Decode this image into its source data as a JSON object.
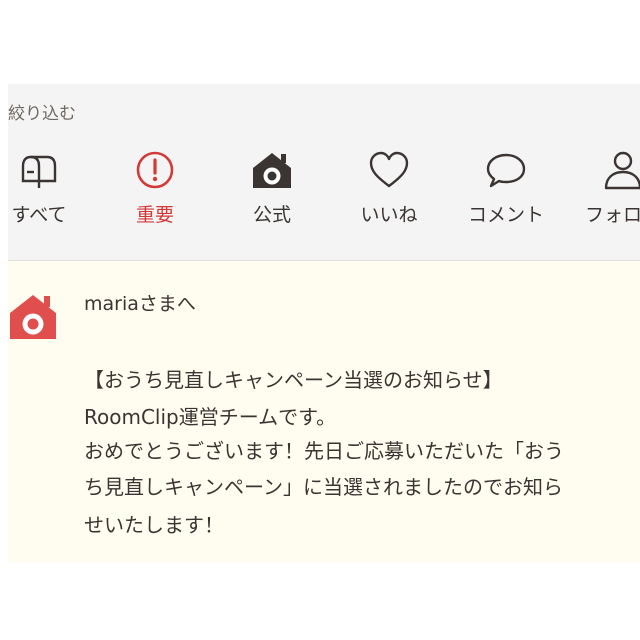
{
  "filter": {
    "label": "絞り込む"
  },
  "tabs": [
    {
      "label": "すべて",
      "icon": "mailbox-icon"
    },
    {
      "label": "重要",
      "icon": "exclamation-circle-icon"
    },
    {
      "label": "公式",
      "icon": "house-camera-icon"
    },
    {
      "label": "いいね",
      "icon": "heart-icon"
    },
    {
      "label": "コメント",
      "icon": "speech-bubble-icon"
    },
    {
      "label": "フォロー",
      "icon": "person-icon"
    }
  ],
  "active_tab": "重要",
  "colors": {
    "accent_red": "#d23a3a",
    "logo_red": "#e14e4e",
    "icon_dark": "#3a3532",
    "filter_bg": "#f5f4f4",
    "notice_bg": "#fffdf0"
  },
  "notification": {
    "recipient": "mariaさまへ",
    "body_lines": [
      "【おうち見直しキャンペーン当選のお知らせ】",
      "RoomClip運営チームです。",
      "おめでとうございます！先日ご応募いただいた「おう",
      "ち見直しキャンペーン」に当選されましたのでお知ら",
      "せいたします！"
    ]
  }
}
